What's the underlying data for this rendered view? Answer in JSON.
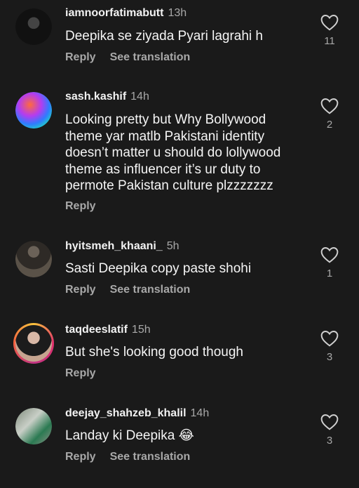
{
  "comments": [
    {
      "username": "iamnoorfatimabutt",
      "time": "13h",
      "text": "Deepika se ziyada Pyari lagrahi h",
      "reply_label": "Reply",
      "translation_label": "See translation",
      "likes": "11",
      "avatar_icon": "profile-avatar"
    },
    {
      "username": "sash.kashif",
      "time": "14h",
      "text": "Looking pretty but Why Bollywood theme yar matlb Pakistani identity doesn’t matter u should do lollywood theme as influencer it’s ur duty to permote Pakistan culture plzzzzzzz",
      "reply_label": "Reply",
      "likes": "2",
      "avatar_icon": "profile-avatar"
    },
    {
      "username": "hyitsmeh_khaani_",
      "time": "5h",
      "text": "Sasti Deepika copy paste shohi",
      "reply_label": "Reply",
      "translation_label": "See translation",
      "likes": "1",
      "avatar_icon": "profile-avatar"
    },
    {
      "username": "taqdeeslatif",
      "time": "15h",
      "text": "But she's looking good though",
      "reply_label": "Reply",
      "likes": "3",
      "avatar_icon": "story-ring-avatar"
    },
    {
      "username": "deejay_shahzeb_khalil",
      "time": "14h",
      "text": "Landay ki Deepika 😂",
      "reply_label": "Reply",
      "translation_label": "See translation",
      "likes": "3",
      "avatar_icon": "profile-avatar"
    }
  ],
  "colors": {
    "background": "#1a1a1a",
    "primary_text": "#f5f5f5",
    "secondary_text": "#a8a8a8"
  }
}
